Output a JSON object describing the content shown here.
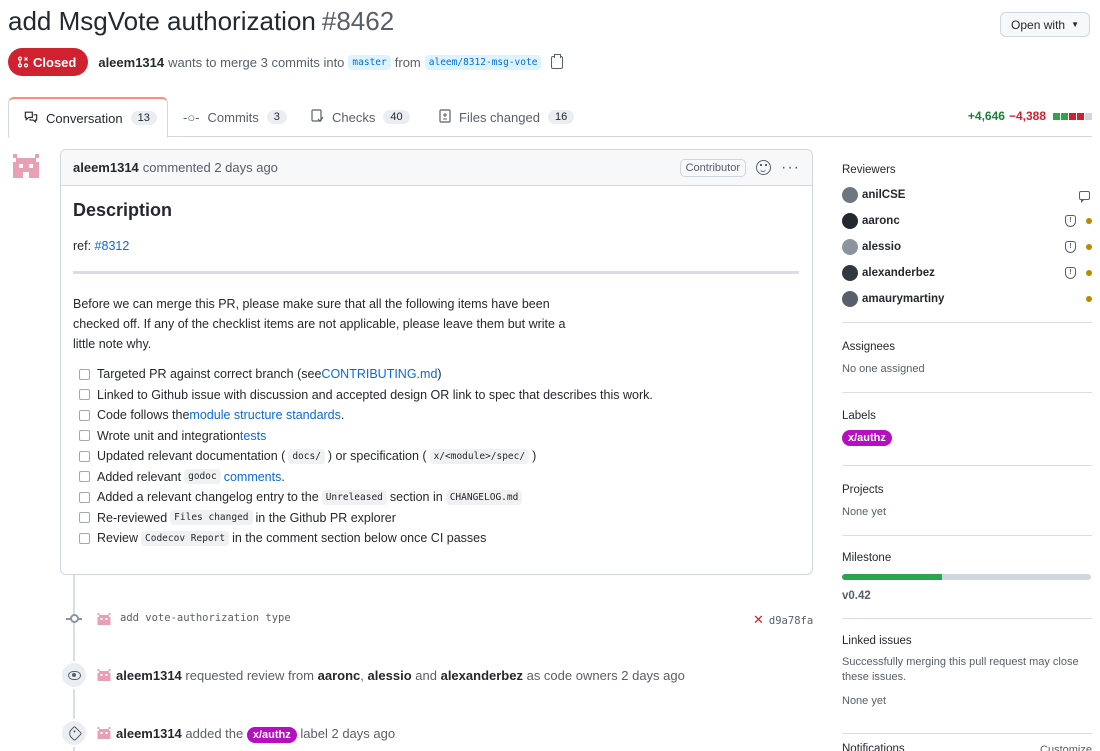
{
  "header": {
    "title": "add MsgVote authorization",
    "number": "#8462",
    "open_with": "Open with"
  },
  "meta": {
    "state": "Closed",
    "author": "aleem1314",
    "text_mid": "wants to merge 3 commits into",
    "base_branch": "master",
    "text_from": "from",
    "head_branch": "aleem/8312-msg-vote"
  },
  "tabs": [
    {
      "label": "Conversation",
      "count": "13",
      "icon": "comment-discussion-icon"
    },
    {
      "label": "Commits",
      "count": "3",
      "icon": "git-commit-icon"
    },
    {
      "label": "Checks",
      "count": "40",
      "icon": "checklist-icon"
    },
    {
      "label": "Files changed",
      "count": "16",
      "icon": "file-diff-icon"
    }
  ],
  "diffstat": {
    "additions": "+4,646",
    "deletions": "−4,388",
    "blocks": [
      "#2da44e",
      "#2da44e",
      "#cf222e",
      "#cf222e",
      "#d0d7de"
    ]
  },
  "comment": {
    "author": "aleem1314",
    "time": "commented 2 days ago",
    "role": "Contributor",
    "heading": "Description",
    "ref_label": "ref:",
    "ref_link": "#8312",
    "para": "Before we can merge this PR, please make sure that all the following items have been checked off. If any of the checklist items are not applicable, please leave them but write a little note why.",
    "checklist": [
      {
        "pre": "Targeted PR against correct branch (see ",
        "link": "CONTRIBUTING.md",
        "post": ")"
      },
      {
        "pre": "Linked to Github issue with discussion and accepted design OR link to spec that describes this work."
      },
      {
        "pre": "Code follows the ",
        "link": "module structure standards",
        "post": "."
      },
      {
        "pre": "Wrote unit and integration ",
        "link": "tests"
      },
      {
        "pre": "Updated relevant documentation (",
        "code": "docs/",
        "mid": ") or specification (",
        "code2": "x/<module>/spec/",
        "post": ")"
      },
      {
        "pre": "Added relevant ",
        "code": "godoc",
        "link": "comments",
        "post": "."
      },
      {
        "pre": "Added a relevant changelog entry to the ",
        "code": "Unreleased",
        "mid": " section in ",
        "code2": "CHANGELOG.md"
      },
      {
        "pre": "Re-reviewed ",
        "code": "Files changed",
        "post": " in the Github PR explorer"
      },
      {
        "pre": "Review ",
        "code": "Codecov Report",
        "post": " in the comment section below once CI passes"
      }
    ]
  },
  "timeline": {
    "commit_msg": "add vote-authorization type",
    "commit_sha": "d9a78fa",
    "review_author": "aleem1314",
    "review_text1": "requested review from",
    "review_r1": "aaronc",
    "review_sep": ",",
    "review_r2": "alessio",
    "review_and": "and",
    "review_r3": "alexanderbez",
    "review_text2": "as code owners 2 days ago",
    "label_author": "aleem1314",
    "label_text1": "added the",
    "label_name": "x/authz",
    "label_text2": "label 2 days ago"
  },
  "sidebar": {
    "reviewers_h": "Reviewers",
    "reviewers": [
      {
        "name": "anilCSE",
        "status": "commented",
        "color": "#6e7781"
      },
      {
        "name": "aaronc",
        "status": "code-owner-pending",
        "color": "#24292f"
      },
      {
        "name": "alessio",
        "status": "code-owner-pending",
        "color": "#8c959f"
      },
      {
        "name": "alexanderbez",
        "status": "code-owner-pending",
        "color": "#32383f"
      },
      {
        "name": "amaurymartiny",
        "status": "pending",
        "color": "#57606a"
      }
    ],
    "assignees_h": "Assignees",
    "assignees_v": "No one assigned",
    "labels_h": "Labels",
    "label": "x/authz",
    "projects_h": "Projects",
    "projects_v": "None yet",
    "milestone_h": "Milestone",
    "milestone_progress": 0.4,
    "milestone_v": "v0.42",
    "linked_h": "Linked issues",
    "linked_desc": "Successfully merging this pull request may close these issues.",
    "linked_v": "None yet",
    "notifications_h": "Notifications",
    "customize": "Customize"
  }
}
